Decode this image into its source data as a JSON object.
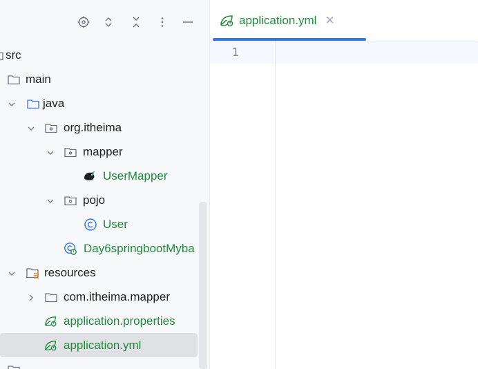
{
  "project_panel": {
    "toolbar_icons": [
      "locate-icon",
      "expand-all-icon",
      "collapse-all-icon",
      "options-icon",
      "hide-icon"
    ],
    "tree": [
      {
        "label": "src",
        "icon": "folder-icon",
        "expanded": true,
        "chevron": false
      },
      {
        "label": "main",
        "icon": "folder-icon",
        "expanded": true,
        "chevron": false
      },
      {
        "label": "java",
        "icon": "source-folder-icon",
        "expanded": true,
        "chevron": true
      },
      {
        "label": "org.itheima",
        "icon": "package-icon",
        "expanded": true,
        "chevron": true
      },
      {
        "label": "mapper",
        "icon": "package-icon",
        "expanded": true,
        "chevron": true
      },
      {
        "label": "UserMapper",
        "icon": "mybatis-bird-icon",
        "color": "#1f8a3c"
      },
      {
        "label": "pojo",
        "icon": "package-icon",
        "expanded": true,
        "chevron": true
      },
      {
        "label": "User",
        "icon": "class-icon",
        "color": "#1f8a3c"
      },
      {
        "label": "Day6springbootMyba",
        "icon": "spring-boot-app-icon",
        "color": "#1f8a3c"
      },
      {
        "label": "resources",
        "icon": "resources-folder-icon",
        "expanded": true,
        "chevron": true
      },
      {
        "label": "com.itheima.mapper",
        "icon": "folder-icon",
        "expanded": false,
        "chevron": true
      },
      {
        "label": "application.properties",
        "icon": "spring-config-icon",
        "color": "#1f8a3c"
      },
      {
        "label": "application.yml",
        "icon": "spring-config-icon",
        "color": "#1f8a3c",
        "selected": true
      }
    ]
  },
  "editor": {
    "tab": {
      "label": "application.yml",
      "icon": "spring-config-icon",
      "active": true
    },
    "line_numbers": [
      "1"
    ]
  },
  "colors": {
    "accent": "#3574f0",
    "green_file": "#1f8a3c",
    "selection": "#dfe1e5"
  }
}
